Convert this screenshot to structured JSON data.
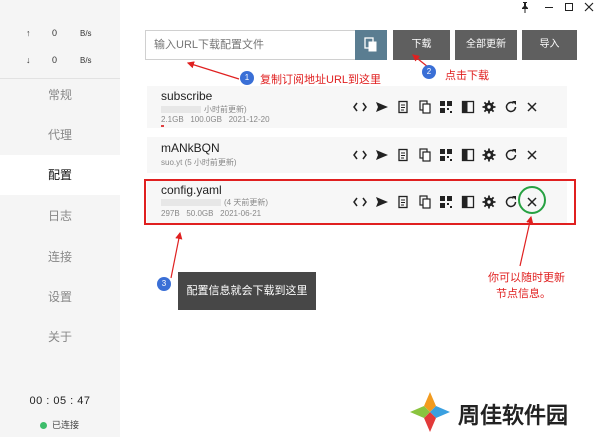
{
  "window": {
    "pin_icon": "pin-icon",
    "minimize_icon": "minimize-icon",
    "maximize_icon": "maximize-icon",
    "close_icon": "close-icon"
  },
  "sidebar": {
    "upload": {
      "arrow": "↑",
      "value": "0",
      "unit": "B/s"
    },
    "download": {
      "arrow": "↓",
      "value": "0",
      "unit": "B/s"
    },
    "items": [
      {
        "label": "常规"
      },
      {
        "label": "代理"
      },
      {
        "label": "配置"
      },
      {
        "label": "日志"
      },
      {
        "label": "连接"
      },
      {
        "label": "设置"
      },
      {
        "label": "关于"
      }
    ],
    "active_item": "配置",
    "timer": "00 : 05 : 47",
    "status": "已连接"
  },
  "toolbar": {
    "url_placeholder": "输入URL下载配置文件",
    "download_label": "下载",
    "update_all_label": "全部更新",
    "import_label": "导入"
  },
  "profiles": [
    {
      "name": "subscribe",
      "updated": "小时前更新)",
      "usage": "2.1GB",
      "total": "100.0GB",
      "date": "2021-12-20"
    },
    {
      "name": "mANkBQN",
      "updated": "suo.yt (5 小时前更新)"
    },
    {
      "name": "config.yaml",
      "updated": "(4 天前更新)",
      "usage": "297B",
      "total": "50.0GB",
      "date": "2021-06-21"
    }
  ],
  "annotations": {
    "step1": {
      "num": "1",
      "text": "复制订阅地址URL到这里"
    },
    "step2": {
      "num": "2",
      "text": "点击下载"
    },
    "step3": {
      "num": "3",
      "text": "配置信息就会下载到这里"
    },
    "refresh_note_line1": "你可以随时更新",
    "refresh_note_line2": "节点信息。"
  },
  "watermark": {
    "text": "周佳软件园"
  },
  "colors": {
    "accent_red": "#e02020",
    "button_gray": "#5f5f5f",
    "paste_blue": "#5a7d91",
    "connected_green": "#3dbd6a",
    "step_blue": "#3a6fd6",
    "refresh_circle": "#27a142"
  }
}
